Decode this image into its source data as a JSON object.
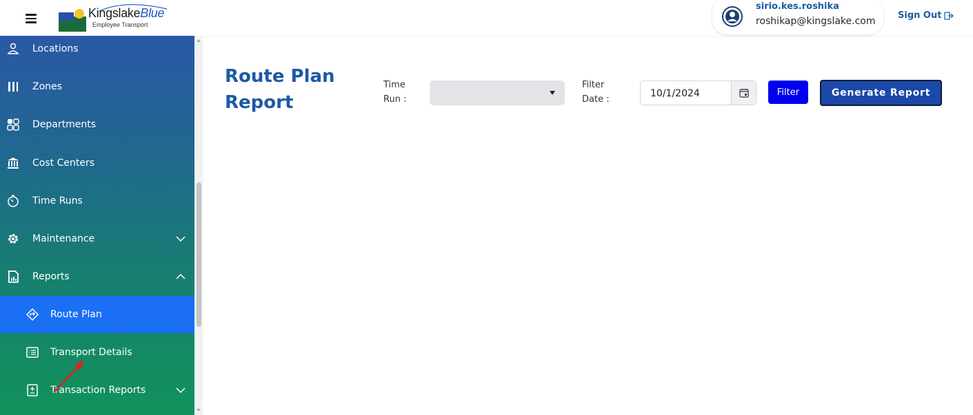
{
  "header": {
    "logo_brand": "Kingslake",
    "logo_brand_accent": "Blue",
    "logo_subtitle": "Employee Transport",
    "user": {
      "name": "sirio.kes.roshika",
      "email": "roshikap@kingslake.com"
    },
    "signout_label": "Sign Out"
  },
  "sidebar": {
    "items": [
      {
        "label": "Locations",
        "icon": "location-person-icon"
      },
      {
        "label": "Zones",
        "icon": "zones-icon"
      },
      {
        "label": "Departments",
        "icon": "departments-grid-icon"
      },
      {
        "label": "Cost Centers",
        "icon": "bank-icon"
      },
      {
        "label": "Time Runs",
        "icon": "timer-icon"
      },
      {
        "label": "Maintenance",
        "icon": "gear-icon",
        "expandable": true,
        "expanded": false
      },
      {
        "label": "Reports",
        "icon": "report-icon",
        "expandable": true,
        "expanded": true
      },
      {
        "label": "Route Plan",
        "icon": "route-diamond-icon",
        "active": true
      },
      {
        "label": "Transport Details",
        "icon": "list-icon"
      },
      {
        "label": "Transaction Reports",
        "icon": "transaction-icon",
        "expandable": true,
        "expanded": false
      }
    ]
  },
  "main": {
    "title": "Route Plan Report",
    "time_run_label_line1": "Time",
    "time_run_label_line2": "Run :",
    "time_run_value": "",
    "filter_date_label_line1": "Filter",
    "filter_date_label_line2": "Date :",
    "filter_date_value": "10/1/2024",
    "filter_button": "Filter",
    "generate_button": "Generate Report"
  },
  "colors": {
    "brand_blue": "#1c5aa6",
    "active_nav": "#1a6ff5",
    "filter_button": "#0000ee",
    "generate_button": "#1c48a8"
  }
}
